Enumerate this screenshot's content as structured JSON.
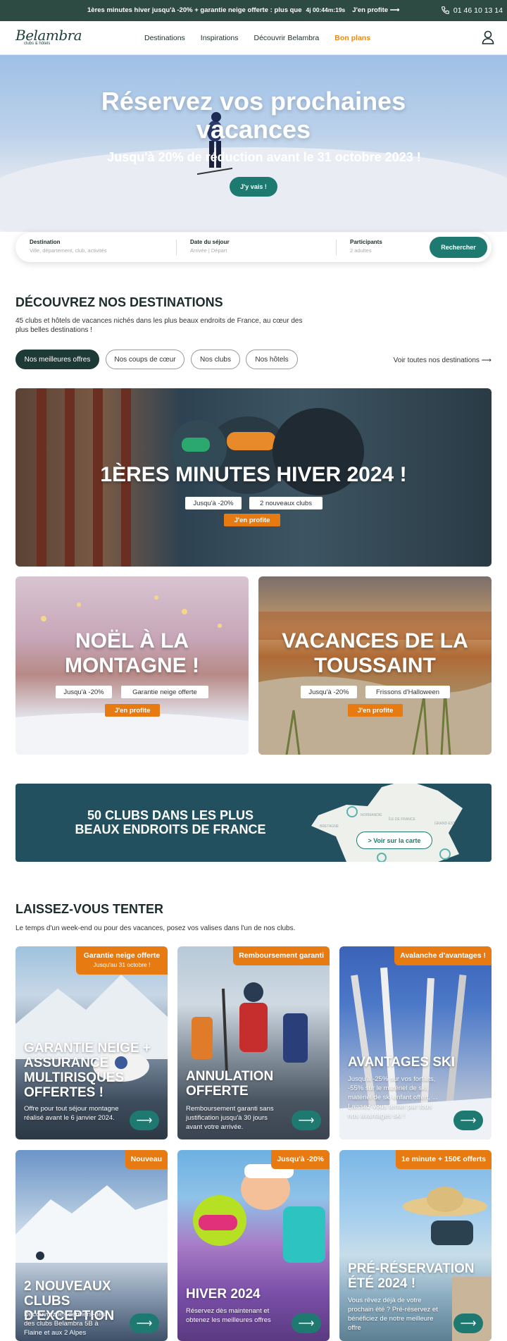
{
  "topbar": {
    "promo": "1ères minutes hiver jusqu'à -20% + garantie neige offerte : plus que",
    "timer": "4j 00:44m:19s",
    "profit": "J'en profite",
    "arrow": "⟶",
    "phone": "01 46 10 13 14"
  },
  "header": {
    "logo": "Belambra",
    "logo_sub": "clubs & hôtels",
    "nav": [
      "Destinations",
      "Inspirations",
      "Découvrir Belambra",
      "Bon plans"
    ]
  },
  "hero": {
    "title": "Réservez vos prochaines vacances",
    "subtitle": "Jusqu'à 20% de réduction avant le 31 octobre 2023 !",
    "button": "J'y vais !"
  },
  "search": {
    "destination_label": "Destination",
    "destination_placeholder": "Ville, département, club, activités",
    "date_label": "Date du séjour",
    "date_placeholder": "Arrivée | Départ",
    "participants_label": "Participants",
    "participants_value": "2 adultes",
    "button": "Rechercher"
  },
  "destinations": {
    "title": "DÉCOUVREZ NOS DESTINATIONS",
    "subtitle": "45 clubs et hôtels de vacances nichés dans les plus beaux endroits de France, au cœur des plus belles destinations !",
    "filters": [
      "Nos meilleures offres",
      "Nos coups de cœur",
      "Nos clubs",
      "Nos hôtels"
    ],
    "see_all": "Voir toutes nos destinations ⟶"
  },
  "cards": [
    {
      "title": "1ÈRES MINUTES HIVER 2024 !",
      "tags": [
        "Jusqu'à -20%",
        "2 nouveaux clubs"
      ],
      "cta": "J'en profite"
    },
    {
      "title": "NOËL À LA MONTAGNE !",
      "tags": [
        "Jusqu'à -20%",
        "Garantie neige offerte"
      ],
      "cta": "J'en profite"
    },
    {
      "title": "VACANCES DE LA TOUSSAINT",
      "tags": [
        "Jusqu'à -20%",
        "Frissons d'Halloween"
      ],
      "cta": "J'en profite"
    }
  ],
  "map": {
    "title": "50 CLUBS DANS LES PLUS BEAUX ENDROITS DE FRANCE",
    "button": "> Voir sur la carte",
    "regions": [
      "NORMANDIE",
      "ÎLE DE FRANCE",
      "GRAND-EST",
      "BRETAGNE"
    ]
  },
  "tempt": {
    "title": "LAISSEZ-VOUS TENTER",
    "subtitle": "Le temps d'un week-end ou pour des vacances, posez vos valises dans l'un de nos clubs."
  },
  "offers": [
    {
      "badge": "Garantie neige offerte",
      "badge_sub": "Jusqu'au 31 octobre !",
      "title": "GARANTIE NEIGE + ASSURANCE MULTIRISQUES OFFERTES !",
      "desc": "Offre pour tout séjour montagne réalisé avant le 6 janvier 2024."
    },
    {
      "badge": "Remboursement garanti",
      "badge_sub": "",
      "title": "ANNULATION OFFERTE",
      "desc": "Remboursement garanti sans justification jusqu'à 30 jours avant votre arrivée."
    },
    {
      "badge": "Avalanche d'avantages !",
      "badge_sub": "",
      "title": "AVANTAGES SKI",
      "desc": "Jusqu'à -25% sur vos forfaits, -55% sur le matériel de ski, matériel de ski enfant offert, ... Laissez-vous tenter par tous nos avantages ski !"
    },
    {
      "badge": "Nouveau",
      "badge_sub": "",
      "title": "2 NOUVEAUX CLUBS D'EXCEPTION",
      "desc": "Découvrez les derniers-nés des clubs Belambra 5B à Flaine et aux 2 Alpes"
    },
    {
      "badge": "Jusqu'à -20%",
      "badge_sub": "",
      "title": "HIVER 2024",
      "desc": "Réservez dès maintenant et obtenez les meilleures offres"
    },
    {
      "badge": "1e minute + 150€ offerts",
      "badge_sub": "",
      "title": "PRÉ-RÉSERVATION ÉTÉ 2024 !",
      "desc": "Vous rêvez déjà de votre prochain été ? Pré-réservez et bénéficiez de notre meilleure offre"
    }
  ],
  "arrow": "⟶",
  "colors": {
    "primary": "#1e7a70",
    "accent": "#e87a12",
    "dark": "#2d4a43",
    "navy": "#23505e"
  }
}
